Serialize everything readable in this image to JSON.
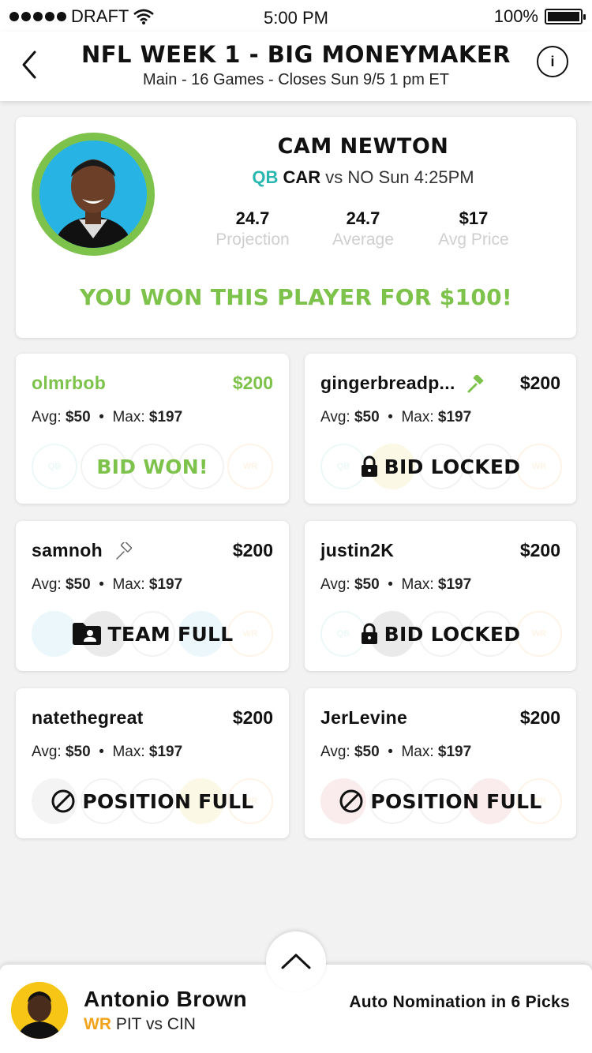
{
  "status": {
    "carrier": "DRAFT",
    "time": "5:00 PM",
    "battery": "100%"
  },
  "header": {
    "title": "NFL WEEK 1 - BIG MONEYMAKER",
    "subtitle": "Main - 16 Games - Closes Sun 9/5 1 pm ET",
    "info_label": "i"
  },
  "player": {
    "name": "CAM NEWTON",
    "position": "QB",
    "team": "CAR",
    "matchup": "vs NO Sun 4:25PM",
    "stats": [
      {
        "value": "24.7",
        "label": "Projection"
      },
      {
        "value": "24.7",
        "label": "Average"
      },
      {
        "value": "$17",
        "label": "Avg Price"
      }
    ],
    "won_banner": "YOU WON THIS PLAYER FOR $100!"
  },
  "bidders": [
    {
      "name": "olmrbob",
      "bid": "$200",
      "avg_label": "Avg:",
      "avg": "$50",
      "max_label": "Max:",
      "max": "$197",
      "status": "BID WON!",
      "highlight": "#7dc24b"
    },
    {
      "name": "gingerbreadp...",
      "bid": "$200",
      "avg_label": "Avg:",
      "avg": "$50",
      "max_label": "Max:",
      "max": "$197",
      "status": "BID LOCKED"
    },
    {
      "name": "samnoh",
      "bid": "$200",
      "avg_label": "Avg:",
      "avg": "$50",
      "max_label": "Max:",
      "max": "$197",
      "status": "TEAM FULL"
    },
    {
      "name": "justin2K",
      "bid": "$200",
      "avg_label": "Avg:",
      "avg": "$50",
      "max_label": "Max:",
      "max": "$197",
      "status": "BID LOCKED"
    },
    {
      "name": "natethegreat",
      "bid": "$200",
      "avg_label": "Avg:",
      "avg": "$50",
      "max_label": "Max:",
      "max": "$197",
      "status": "POSITION FULL"
    },
    {
      "name": "JerLevine",
      "bid": "$200",
      "avg_label": "Avg:",
      "avg": "$50",
      "max_label": "Max:",
      "max": "$197",
      "status": "POSITION FULL"
    }
  ],
  "slot_labels": {
    "qb": "QB",
    "wr": "WR"
  },
  "bottom": {
    "player_name": "Antonio Brown",
    "position": "WR",
    "matchup": "PIT vs CIN",
    "auto_nomination": "Auto Nomination in 6 Picks"
  },
  "colors": {
    "green": "#7dc24b",
    "teal": "#2ab7b0",
    "orange": "#f2a31c"
  }
}
